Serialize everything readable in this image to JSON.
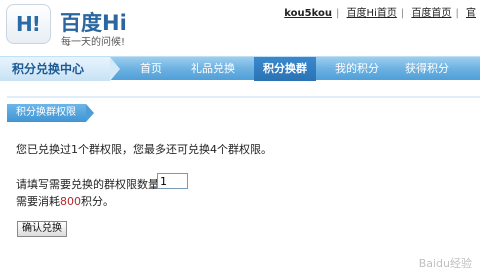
{
  "header": {
    "logo_badge": "H!",
    "logo_text": "百度Hi",
    "slogan": "每一天的问候!"
  },
  "toplinks": {
    "user": "kou5kou",
    "hi_home": "百度Hi首页",
    "baidu_home": "百度首页",
    "partial": "官"
  },
  "nav": {
    "title": "积分兑换中心",
    "items": [
      "首页",
      "礼品兑换",
      "积分换群",
      "我的积分",
      "获得积分"
    ],
    "active_index": 2
  },
  "section": {
    "tab": "积分换群权限",
    "info": "您已兑换过1个群权限，您最多还可兑换4个群权限。",
    "qty_label": "请填写需要兑换的群权限数量：",
    "qty_value": "1",
    "cost_prefix": "需要消耗",
    "cost_value": "800",
    "cost_suffix": "积分。",
    "confirm_button": "确认兑换"
  },
  "watermark": "Baidu经验",
  "colors": {
    "nav_blue": "#4f9fd9",
    "nav_active": "#2a73b5",
    "logo_blue": "#2c66a0",
    "cost_red": "#b32a2a"
  }
}
